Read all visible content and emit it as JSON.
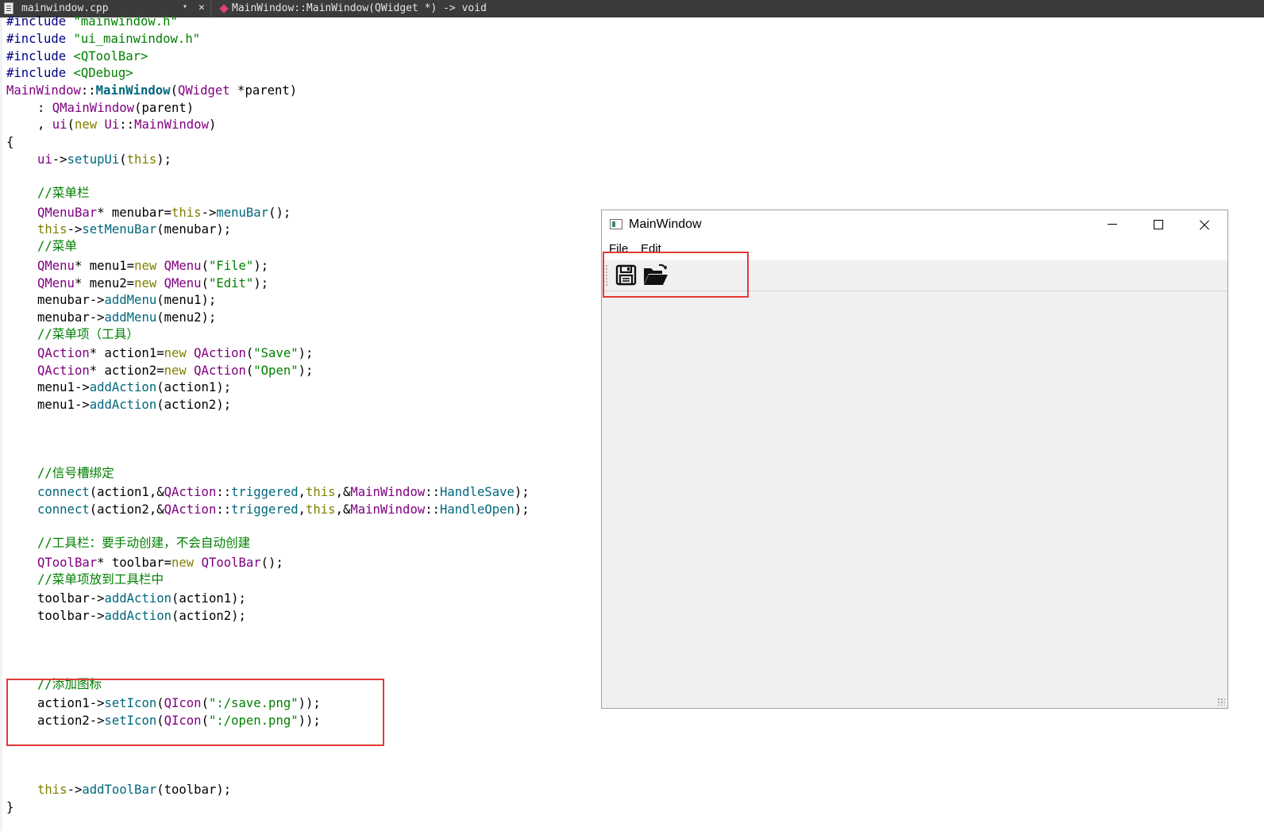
{
  "editor": {
    "file_tab": "mainwindow.cpp",
    "dropdown_glyph": "▾",
    "close_glyph": "✕",
    "function_signature": "MainWindow::MainWindow(QWidget *) -> void",
    "code_lines": [
      {
        "indent": false,
        "spans": [
          {
            "c": "pp",
            "t": "#include "
          },
          {
            "c": "str",
            "t": "\"mainwindow.h\""
          }
        ]
      },
      {
        "indent": false,
        "spans": [
          {
            "c": "pp",
            "t": "#include "
          },
          {
            "c": "str",
            "t": "\"ui_mainwindow.h\""
          }
        ]
      },
      {
        "indent": false,
        "spans": [
          {
            "c": "pp",
            "t": "#include "
          },
          {
            "c": "str",
            "t": "<QToolBar>"
          }
        ]
      },
      {
        "indent": false,
        "spans": [
          {
            "c": "pp",
            "t": "#include "
          },
          {
            "c": "str",
            "t": "<QDebug>"
          }
        ]
      },
      {
        "indent": false,
        "spans": [
          {
            "c": "ty",
            "t": "MainWindow"
          },
          {
            "c": "",
            "t": "::"
          },
          {
            "c": "fb",
            "t": "MainWindow"
          },
          {
            "c": "",
            "t": "("
          },
          {
            "c": "ty",
            "t": "QWidget"
          },
          {
            "c": "",
            "t": " *parent)"
          }
        ]
      },
      {
        "indent": true,
        "spans": [
          {
            "c": "",
            "t": ": "
          },
          {
            "c": "ty",
            "t": "QMainWindow"
          },
          {
            "c": "",
            "t": "(parent)"
          }
        ]
      },
      {
        "indent": true,
        "spans": [
          {
            "c": "",
            "t": ", "
          },
          {
            "c": "ty",
            "t": "ui"
          },
          {
            "c": "",
            "t": "("
          },
          {
            "c": "kw",
            "t": "new"
          },
          {
            "c": "",
            "t": " "
          },
          {
            "c": "ty",
            "t": "Ui"
          },
          {
            "c": "",
            "t": "::"
          },
          {
            "c": "ty",
            "t": "MainWindow"
          },
          {
            "c": "",
            "t": ")"
          }
        ]
      },
      {
        "indent": false,
        "spans": [
          {
            "c": "",
            "t": "{"
          }
        ]
      },
      {
        "indent": true,
        "spans": [
          {
            "c": "ty",
            "t": "ui"
          },
          {
            "c": "",
            "t": "->"
          },
          {
            "c": "fn",
            "t": "setupUi"
          },
          {
            "c": "",
            "t": "("
          },
          {
            "c": "kw",
            "t": "this"
          },
          {
            "c": "",
            "t": ");"
          }
        ]
      },
      {
        "indent": false,
        "spans": []
      },
      {
        "indent": true,
        "spans": [
          {
            "c": "cm",
            "t": "//菜单栏"
          }
        ]
      },
      {
        "indent": true,
        "spans": [
          {
            "c": "ty",
            "t": "QMenuBar"
          },
          {
            "c": "",
            "t": "* menubar="
          },
          {
            "c": "kw",
            "t": "this"
          },
          {
            "c": "",
            "t": "->"
          },
          {
            "c": "fn",
            "t": "menuBar"
          },
          {
            "c": "",
            "t": "();"
          }
        ]
      },
      {
        "indent": true,
        "spans": [
          {
            "c": "kw",
            "t": "this"
          },
          {
            "c": "",
            "t": "->"
          },
          {
            "c": "fn",
            "t": "setMenuBar"
          },
          {
            "c": "",
            "t": "(menubar);"
          }
        ]
      },
      {
        "indent": true,
        "spans": [
          {
            "c": "cm",
            "t": "//菜单"
          }
        ]
      },
      {
        "indent": true,
        "spans": [
          {
            "c": "ty",
            "t": "QMenu"
          },
          {
            "c": "",
            "t": "* menu1="
          },
          {
            "c": "kw",
            "t": "new"
          },
          {
            "c": "",
            "t": " "
          },
          {
            "c": "ty",
            "t": "QMenu"
          },
          {
            "c": "",
            "t": "("
          },
          {
            "c": "str",
            "t": "\"File\""
          },
          {
            "c": "",
            "t": ");"
          }
        ]
      },
      {
        "indent": true,
        "spans": [
          {
            "c": "ty",
            "t": "QMenu"
          },
          {
            "c": "",
            "t": "* menu2="
          },
          {
            "c": "kw",
            "t": "new"
          },
          {
            "c": "",
            "t": " "
          },
          {
            "c": "ty",
            "t": "QMenu"
          },
          {
            "c": "",
            "t": "("
          },
          {
            "c": "str",
            "t": "\"Edit\""
          },
          {
            "c": "",
            "t": ");"
          }
        ]
      },
      {
        "indent": true,
        "spans": [
          {
            "c": "",
            "t": "menubar->"
          },
          {
            "c": "fn",
            "t": "addMenu"
          },
          {
            "c": "",
            "t": "(menu1);"
          }
        ]
      },
      {
        "indent": true,
        "spans": [
          {
            "c": "",
            "t": "menubar->"
          },
          {
            "c": "fn",
            "t": "addMenu"
          },
          {
            "c": "",
            "t": "(menu2);"
          }
        ]
      },
      {
        "indent": true,
        "spans": [
          {
            "c": "cm",
            "t": "//菜单项（工具）"
          }
        ]
      },
      {
        "indent": true,
        "spans": [
          {
            "c": "ty",
            "t": "QAction"
          },
          {
            "c": "",
            "t": "* action1="
          },
          {
            "c": "kw",
            "t": "new"
          },
          {
            "c": "",
            "t": " "
          },
          {
            "c": "ty",
            "t": "QAction"
          },
          {
            "c": "",
            "t": "("
          },
          {
            "c": "str",
            "t": "\"Save\""
          },
          {
            "c": "",
            "t": ");"
          }
        ]
      },
      {
        "indent": true,
        "spans": [
          {
            "c": "ty",
            "t": "QAction"
          },
          {
            "c": "",
            "t": "* action2="
          },
          {
            "c": "kw",
            "t": "new"
          },
          {
            "c": "",
            "t": " "
          },
          {
            "c": "ty",
            "t": "QAction"
          },
          {
            "c": "",
            "t": "("
          },
          {
            "c": "str",
            "t": "\"Open\""
          },
          {
            "c": "",
            "t": ");"
          }
        ]
      },
      {
        "indent": true,
        "spans": [
          {
            "c": "",
            "t": "menu1->"
          },
          {
            "c": "fn",
            "t": "addAction"
          },
          {
            "c": "",
            "t": "(action1);"
          }
        ]
      },
      {
        "indent": true,
        "spans": [
          {
            "c": "",
            "t": "menu1->"
          },
          {
            "c": "fn",
            "t": "addAction"
          },
          {
            "c": "",
            "t": "(action2);"
          }
        ]
      },
      {
        "indent": false,
        "spans": []
      },
      {
        "indent": false,
        "spans": []
      },
      {
        "indent": false,
        "spans": []
      },
      {
        "indent": true,
        "spans": [
          {
            "c": "cm",
            "t": "//信号槽绑定"
          }
        ]
      },
      {
        "indent": true,
        "spans": [
          {
            "c": "fn",
            "t": "connect"
          },
          {
            "c": "",
            "t": "(action1,&"
          },
          {
            "c": "ty",
            "t": "QAction"
          },
          {
            "c": "",
            "t": "::"
          },
          {
            "c": "fn",
            "t": "triggered"
          },
          {
            "c": "",
            "t": ","
          },
          {
            "c": "kw",
            "t": "this"
          },
          {
            "c": "",
            "t": ",&"
          },
          {
            "c": "ty",
            "t": "MainWindow"
          },
          {
            "c": "",
            "t": "::"
          },
          {
            "c": "fn",
            "t": "HandleSave"
          },
          {
            "c": "",
            "t": ");"
          }
        ]
      },
      {
        "indent": true,
        "spans": [
          {
            "c": "fn",
            "t": "connect"
          },
          {
            "c": "",
            "t": "(action2,&"
          },
          {
            "c": "ty",
            "t": "QAction"
          },
          {
            "c": "",
            "t": "::"
          },
          {
            "c": "fn",
            "t": "triggered"
          },
          {
            "c": "",
            "t": ","
          },
          {
            "c": "kw",
            "t": "this"
          },
          {
            "c": "",
            "t": ",&"
          },
          {
            "c": "ty",
            "t": "MainWindow"
          },
          {
            "c": "",
            "t": "::"
          },
          {
            "c": "fn",
            "t": "HandleOpen"
          },
          {
            "c": "",
            "t": ");"
          }
        ]
      },
      {
        "indent": false,
        "spans": []
      },
      {
        "indent": true,
        "spans": [
          {
            "c": "cm",
            "t": "//工具栏：要手动创建，不会自动创建"
          }
        ]
      },
      {
        "indent": true,
        "spans": [
          {
            "c": "ty",
            "t": "QToolBar"
          },
          {
            "c": "",
            "t": "* toolbar="
          },
          {
            "c": "kw",
            "t": "new"
          },
          {
            "c": "",
            "t": " "
          },
          {
            "c": "ty",
            "t": "QToolBar"
          },
          {
            "c": "",
            "t": "();"
          }
        ]
      },
      {
        "indent": true,
        "spans": [
          {
            "c": "cm",
            "t": "//菜单项放到工具栏中"
          }
        ]
      },
      {
        "indent": true,
        "spans": [
          {
            "c": "",
            "t": "toolbar->"
          },
          {
            "c": "fn",
            "t": "addAction"
          },
          {
            "c": "",
            "t": "(action1);"
          }
        ]
      },
      {
        "indent": true,
        "spans": [
          {
            "c": "",
            "t": "toolbar->"
          },
          {
            "c": "fn",
            "t": "addAction"
          },
          {
            "c": "",
            "t": "(action2);"
          }
        ]
      },
      {
        "indent": false,
        "spans": []
      },
      {
        "indent": false,
        "spans": []
      },
      {
        "indent": false,
        "spans": []
      },
      {
        "indent": true,
        "spans": [
          {
            "c": "cm",
            "t": "//添加图标"
          }
        ]
      },
      {
        "indent": true,
        "spans": [
          {
            "c": "",
            "t": "action1->"
          },
          {
            "c": "fn",
            "t": "setIcon"
          },
          {
            "c": "",
            "t": "("
          },
          {
            "c": "ty",
            "t": "QIcon"
          },
          {
            "c": "",
            "t": "("
          },
          {
            "c": "str",
            "t": "\":/save.png\""
          },
          {
            "c": "",
            "t": "));"
          }
        ]
      },
      {
        "indent": true,
        "spans": [
          {
            "c": "",
            "t": "action2->"
          },
          {
            "c": "fn",
            "t": "setIcon"
          },
          {
            "c": "",
            "t": "("
          },
          {
            "c": "ty",
            "t": "QIcon"
          },
          {
            "c": "",
            "t": "("
          },
          {
            "c": "str",
            "t": "\":/open.png\""
          },
          {
            "c": "",
            "t": "));"
          }
        ]
      },
      {
        "indent": false,
        "spans": []
      },
      {
        "indent": false,
        "spans": []
      },
      {
        "indent": false,
        "spans": []
      },
      {
        "indent": true,
        "spans": [
          {
            "c": "kw",
            "t": "this"
          },
          {
            "c": "",
            "t": "->"
          },
          {
            "c": "fn",
            "t": "addToolBar"
          },
          {
            "c": "",
            "t": "(toolbar);"
          }
        ]
      },
      {
        "indent": false,
        "spans": [
          {
            "c": "",
            "t": "}"
          }
        ]
      }
    ]
  },
  "qt_window": {
    "title": "MainWindow",
    "menus": [
      "File",
      "Edit"
    ],
    "toolbar_icons": [
      "save-icon",
      "open-folder-icon"
    ]
  },
  "colors": {
    "highlight": "#e53935",
    "topbar": "#3b3b3b",
    "preprocessor": "#000080",
    "string": "#008000",
    "type": "#800080",
    "keyword": "#808000",
    "function": "#00677c"
  }
}
